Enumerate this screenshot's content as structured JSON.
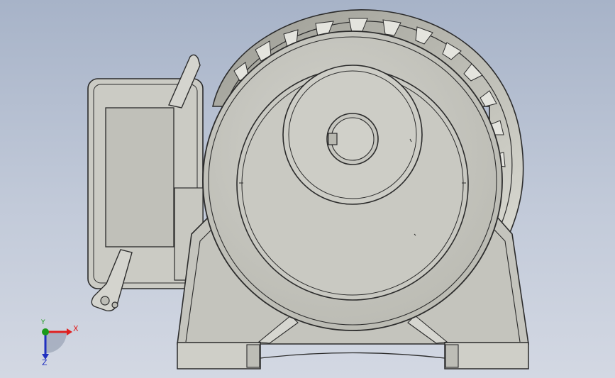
{
  "viewport": {
    "background_top": "#a7b3c8",
    "background_bottom": "#d3d8e3",
    "model_fill": "#c6c6bf",
    "model_edge": "#2b2b2b"
  },
  "triad": {
    "x_label": "X",
    "y_label": "Y",
    "z_label": "Z",
    "x_color": "#e02020",
    "y_color": "#1a9a1a",
    "z_color": "#2030c0"
  }
}
